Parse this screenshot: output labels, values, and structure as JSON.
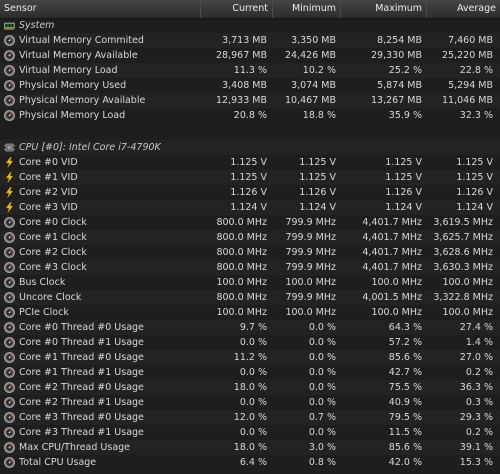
{
  "header": {
    "sensor": "Sensor",
    "current": "Current",
    "minimum": "Minimum",
    "maximum": "Maximum",
    "average": "Average"
  },
  "rows": [
    {
      "type": "section",
      "icon": "memory-chip-icon",
      "label": "System"
    },
    {
      "type": "data",
      "icon": "gauge-icon",
      "label": "Virtual Memory Commited",
      "current": "3,713 MB",
      "minimum": "3,350 MB",
      "maximum": "8,254 MB",
      "average": "7,460 MB"
    },
    {
      "type": "data",
      "icon": "gauge-icon",
      "label": "Virtual Memory Available",
      "current": "28,967 MB",
      "minimum": "24,426 MB",
      "maximum": "29,330 MB",
      "average": "25,220 MB"
    },
    {
      "type": "data",
      "icon": "gauge-icon",
      "label": "Virtual Memory Load",
      "current": "11.3 %",
      "minimum": "10.2 %",
      "maximum": "25.2 %",
      "average": "22.8 %"
    },
    {
      "type": "data",
      "icon": "gauge-icon",
      "label": "Physical Memory Used",
      "current": "3,408 MB",
      "minimum": "3,074 MB",
      "maximum": "5,874 MB",
      "average": "5,294 MB"
    },
    {
      "type": "data",
      "icon": "gauge-icon",
      "label": "Physical Memory Available",
      "current": "12,933 MB",
      "minimum": "10,467 MB",
      "maximum": "13,267 MB",
      "average": "11,046 MB"
    },
    {
      "type": "data",
      "icon": "gauge-icon",
      "label": "Physical Memory Load",
      "current": "20.8 %",
      "minimum": "18.8 %",
      "maximum": "35.9 %",
      "average": "32.3 %"
    },
    {
      "type": "gap"
    },
    {
      "type": "section",
      "icon": "cpu-chip-icon",
      "label": "CPU [#0]: Intel Core i7-4790K"
    },
    {
      "type": "data",
      "icon": "lightning-icon",
      "label": "Core #0 VID",
      "current": "1.125 V",
      "minimum": "1.125 V",
      "maximum": "1.125 V",
      "average": "1.125 V"
    },
    {
      "type": "data",
      "icon": "lightning-icon",
      "label": "Core #1 VID",
      "current": "1.125 V",
      "minimum": "1.125 V",
      "maximum": "1.125 V",
      "average": "1.125 V"
    },
    {
      "type": "data",
      "icon": "lightning-icon",
      "label": "Core #2 VID",
      "current": "1.126 V",
      "minimum": "1.126 V",
      "maximum": "1.126 V",
      "average": "1.126 V"
    },
    {
      "type": "data",
      "icon": "lightning-icon",
      "label": "Core #3 VID",
      "current": "1.124 V",
      "minimum": "1.124 V",
      "maximum": "1.124 V",
      "average": "1.124 V"
    },
    {
      "type": "data",
      "icon": "gauge-icon",
      "label": "Core #0 Clock",
      "current": "800.0 MHz",
      "minimum": "799.9 MHz",
      "maximum": "4,401.7 MHz",
      "average": "3,619.5 MHz"
    },
    {
      "type": "data",
      "icon": "gauge-icon",
      "label": "Core #1 Clock",
      "current": "800.0 MHz",
      "minimum": "799.9 MHz",
      "maximum": "4,401.7 MHz",
      "average": "3,625.7 MHz"
    },
    {
      "type": "data",
      "icon": "gauge-icon",
      "label": "Core #2 Clock",
      "current": "800.0 MHz",
      "minimum": "799.9 MHz",
      "maximum": "4,401.7 MHz",
      "average": "3,628.6 MHz"
    },
    {
      "type": "data",
      "icon": "gauge-icon",
      "label": "Core #3 Clock",
      "current": "800.0 MHz",
      "minimum": "799.9 MHz",
      "maximum": "4,401.7 MHz",
      "average": "3,630.3 MHz"
    },
    {
      "type": "data",
      "icon": "gauge-icon",
      "label": "Bus Clock",
      "current": "100.0 MHz",
      "minimum": "100.0 MHz",
      "maximum": "100.0 MHz",
      "average": "100.0 MHz"
    },
    {
      "type": "data",
      "icon": "gauge-icon",
      "label": "Uncore Clock",
      "current": "800.0 MHz",
      "minimum": "799.9 MHz",
      "maximum": "4,001.5 MHz",
      "average": "3,322.8 MHz"
    },
    {
      "type": "data",
      "icon": "gauge-icon",
      "label": "PCIe Clock",
      "current": "100.0 MHz",
      "minimum": "100.0 MHz",
      "maximum": "100.0 MHz",
      "average": "100.0 MHz"
    },
    {
      "type": "data",
      "icon": "gauge-icon",
      "label": "Core #0 Thread #0 Usage",
      "current": "9.7 %",
      "minimum": "0.0 %",
      "maximum": "64.3 %",
      "average": "27.4 %"
    },
    {
      "type": "data",
      "icon": "gauge-icon",
      "label": "Core #0 Thread #1 Usage",
      "current": "0.0 %",
      "minimum": "0.0 %",
      "maximum": "57.2 %",
      "average": "1.4 %"
    },
    {
      "type": "data",
      "icon": "gauge-icon",
      "label": "Core #1 Thread #0 Usage",
      "current": "11.2 %",
      "minimum": "0.0 %",
      "maximum": "85.6 %",
      "average": "27.0 %"
    },
    {
      "type": "data",
      "icon": "gauge-icon",
      "label": "Core #1 Thread #1 Usage",
      "current": "0.0 %",
      "minimum": "0.0 %",
      "maximum": "42.7 %",
      "average": "0.2 %"
    },
    {
      "type": "data",
      "icon": "gauge-icon",
      "label": "Core #2 Thread #0 Usage",
      "current": "18.0 %",
      "minimum": "0.0 %",
      "maximum": "75.5 %",
      "average": "36.3 %"
    },
    {
      "type": "data",
      "icon": "gauge-icon",
      "label": "Core #2 Thread #1 Usage",
      "current": "0.0 %",
      "minimum": "0.0 %",
      "maximum": "40.9 %",
      "average": "0.3 %"
    },
    {
      "type": "data",
      "icon": "gauge-icon",
      "label": "Core #3 Thread #0 Usage",
      "current": "12.0 %",
      "minimum": "0.7 %",
      "maximum": "79.5 %",
      "average": "29.3 %"
    },
    {
      "type": "data",
      "icon": "gauge-icon",
      "label": "Core #3 Thread #1 Usage",
      "current": "0.0 %",
      "minimum": "0.0 %",
      "maximum": "11.5 %",
      "average": "0.2 %"
    },
    {
      "type": "data",
      "icon": "gauge-icon",
      "label": "Max CPU/Thread Usage",
      "current": "18.0 %",
      "minimum": "3.0 %",
      "maximum": "85.6 %",
      "average": "39.1 %"
    },
    {
      "type": "data",
      "icon": "gauge-icon",
      "label": "Total CPU Usage",
      "current": "6.4 %",
      "minimum": "0.8 %",
      "maximum": "42.0 %",
      "average": "15.3 %"
    }
  ]
}
